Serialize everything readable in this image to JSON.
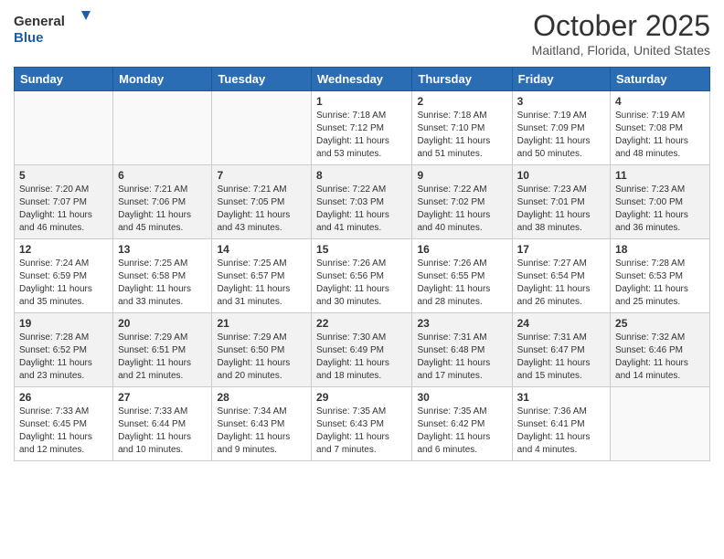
{
  "header": {
    "logo_general": "General",
    "logo_blue": "Blue",
    "title": "October 2025",
    "subtitle": "Maitland, Florida, United States"
  },
  "calendar": {
    "days_of_week": [
      "Sunday",
      "Monday",
      "Tuesday",
      "Wednesday",
      "Thursday",
      "Friday",
      "Saturday"
    ],
    "weeks": [
      [
        {
          "day": "",
          "info": ""
        },
        {
          "day": "",
          "info": ""
        },
        {
          "day": "",
          "info": ""
        },
        {
          "day": "1",
          "info": "Sunrise: 7:18 AM\nSunset: 7:12 PM\nDaylight: 11 hours\nand 53 minutes."
        },
        {
          "day": "2",
          "info": "Sunrise: 7:18 AM\nSunset: 7:10 PM\nDaylight: 11 hours\nand 51 minutes."
        },
        {
          "day": "3",
          "info": "Sunrise: 7:19 AM\nSunset: 7:09 PM\nDaylight: 11 hours\nand 50 minutes."
        },
        {
          "day": "4",
          "info": "Sunrise: 7:19 AM\nSunset: 7:08 PM\nDaylight: 11 hours\nand 48 minutes."
        }
      ],
      [
        {
          "day": "5",
          "info": "Sunrise: 7:20 AM\nSunset: 7:07 PM\nDaylight: 11 hours\nand 46 minutes."
        },
        {
          "day": "6",
          "info": "Sunrise: 7:21 AM\nSunset: 7:06 PM\nDaylight: 11 hours\nand 45 minutes."
        },
        {
          "day": "7",
          "info": "Sunrise: 7:21 AM\nSunset: 7:05 PM\nDaylight: 11 hours\nand 43 minutes."
        },
        {
          "day": "8",
          "info": "Sunrise: 7:22 AM\nSunset: 7:03 PM\nDaylight: 11 hours\nand 41 minutes."
        },
        {
          "day": "9",
          "info": "Sunrise: 7:22 AM\nSunset: 7:02 PM\nDaylight: 11 hours\nand 40 minutes."
        },
        {
          "day": "10",
          "info": "Sunrise: 7:23 AM\nSunset: 7:01 PM\nDaylight: 11 hours\nand 38 minutes."
        },
        {
          "day": "11",
          "info": "Sunrise: 7:23 AM\nSunset: 7:00 PM\nDaylight: 11 hours\nand 36 minutes."
        }
      ],
      [
        {
          "day": "12",
          "info": "Sunrise: 7:24 AM\nSunset: 6:59 PM\nDaylight: 11 hours\nand 35 minutes."
        },
        {
          "day": "13",
          "info": "Sunrise: 7:25 AM\nSunset: 6:58 PM\nDaylight: 11 hours\nand 33 minutes."
        },
        {
          "day": "14",
          "info": "Sunrise: 7:25 AM\nSunset: 6:57 PM\nDaylight: 11 hours\nand 31 minutes."
        },
        {
          "day": "15",
          "info": "Sunrise: 7:26 AM\nSunset: 6:56 PM\nDaylight: 11 hours\nand 30 minutes."
        },
        {
          "day": "16",
          "info": "Sunrise: 7:26 AM\nSunset: 6:55 PM\nDaylight: 11 hours\nand 28 minutes."
        },
        {
          "day": "17",
          "info": "Sunrise: 7:27 AM\nSunset: 6:54 PM\nDaylight: 11 hours\nand 26 minutes."
        },
        {
          "day": "18",
          "info": "Sunrise: 7:28 AM\nSunset: 6:53 PM\nDaylight: 11 hours\nand 25 minutes."
        }
      ],
      [
        {
          "day": "19",
          "info": "Sunrise: 7:28 AM\nSunset: 6:52 PM\nDaylight: 11 hours\nand 23 minutes."
        },
        {
          "day": "20",
          "info": "Sunrise: 7:29 AM\nSunset: 6:51 PM\nDaylight: 11 hours\nand 21 minutes."
        },
        {
          "day": "21",
          "info": "Sunrise: 7:29 AM\nSunset: 6:50 PM\nDaylight: 11 hours\nand 20 minutes."
        },
        {
          "day": "22",
          "info": "Sunrise: 7:30 AM\nSunset: 6:49 PM\nDaylight: 11 hours\nand 18 minutes."
        },
        {
          "day": "23",
          "info": "Sunrise: 7:31 AM\nSunset: 6:48 PM\nDaylight: 11 hours\nand 17 minutes."
        },
        {
          "day": "24",
          "info": "Sunrise: 7:31 AM\nSunset: 6:47 PM\nDaylight: 11 hours\nand 15 minutes."
        },
        {
          "day": "25",
          "info": "Sunrise: 7:32 AM\nSunset: 6:46 PM\nDaylight: 11 hours\nand 14 minutes."
        }
      ],
      [
        {
          "day": "26",
          "info": "Sunrise: 7:33 AM\nSunset: 6:45 PM\nDaylight: 11 hours\nand 12 minutes."
        },
        {
          "day": "27",
          "info": "Sunrise: 7:33 AM\nSunset: 6:44 PM\nDaylight: 11 hours\nand 10 minutes."
        },
        {
          "day": "28",
          "info": "Sunrise: 7:34 AM\nSunset: 6:43 PM\nDaylight: 11 hours\nand 9 minutes."
        },
        {
          "day": "29",
          "info": "Sunrise: 7:35 AM\nSunset: 6:43 PM\nDaylight: 11 hours\nand 7 minutes."
        },
        {
          "day": "30",
          "info": "Sunrise: 7:35 AM\nSunset: 6:42 PM\nDaylight: 11 hours\nand 6 minutes."
        },
        {
          "day": "31",
          "info": "Sunrise: 7:36 AM\nSunset: 6:41 PM\nDaylight: 11 hours\nand 4 minutes."
        },
        {
          "day": "",
          "info": ""
        }
      ]
    ]
  }
}
